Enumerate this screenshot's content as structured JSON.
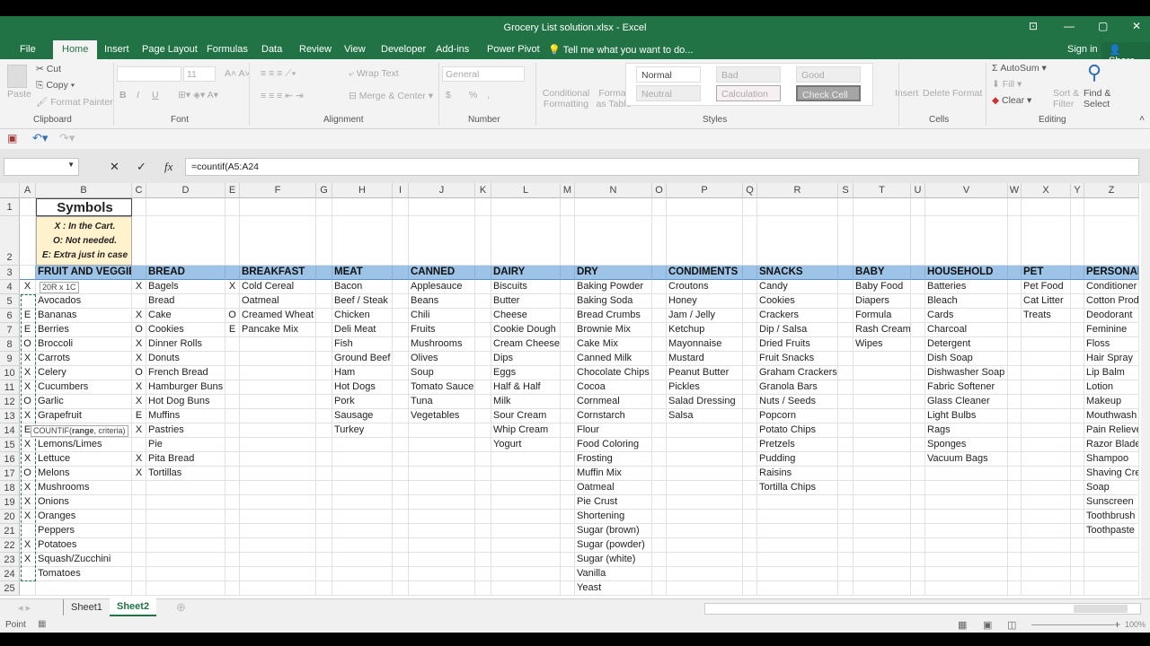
{
  "window": {
    "title": "Grocery List solution.xlsx - Excel",
    "sign_in": "Sign in",
    "share": "Share"
  },
  "menu_tabs": [
    "File",
    "Home",
    "Insert",
    "Page Layout",
    "Formulas",
    "Data",
    "Review",
    "View",
    "Developer",
    "Add-ins",
    "Power Pivot"
  ],
  "tell_me": "Tell me what you want to do...",
  "ribbon": {
    "clipboard": {
      "paste": "Paste",
      "cut": "Cut",
      "copy": "Copy",
      "format_painter": "Format Painter",
      "label": "Clipboard"
    },
    "font": {
      "size": "11",
      "bold": "B",
      "italic": "I",
      "underline": "U",
      "label": "Font"
    },
    "alignment": {
      "wrap_text": "Wrap Text",
      "merge_center": "Merge & Center",
      "label": "Alignment"
    },
    "number": {
      "format": "General",
      "currency": "$",
      "percent": "%",
      "comma": ",",
      "label": "Number"
    },
    "styles": {
      "conditional": "Conditional Formatting",
      "format_table": "Format as Table",
      "normal": "Normal",
      "bad": "Bad",
      "good": "Good",
      "neutral": "Neutral",
      "calculation": "Calculation",
      "check_cell": "Check Cell",
      "label": "Styles"
    },
    "cells": {
      "insert": "Insert",
      "delete": "Delete",
      "format": "Format",
      "label": "Cells"
    },
    "editing": {
      "autosum": "AutoSum",
      "fill": "Fill",
      "clear": "Clear",
      "sort_filter": "Sort & Filter",
      "find_select": "Find & Select",
      "label": "Editing"
    }
  },
  "formula_bar": {
    "name_box": "",
    "formula": "=countif(A5:A24"
  },
  "columns": [
    "A",
    "B",
    "C",
    "D",
    "E",
    "F",
    "G",
    "H",
    "I",
    "J",
    "K",
    "L",
    "M",
    "N",
    "O",
    "P",
    "Q",
    "R",
    "S",
    "T",
    "U",
    "V",
    "W",
    "X",
    "Y",
    "Z"
  ],
  "symbols": {
    "title": "Symbols",
    "lines": [
      "X : In the Cart.",
      "O: Not needed.",
      "E: Extra just in case"
    ]
  },
  "categories": [
    {
      "header": "FRUIT AND VEGGIES",
      "marks": [
        "X",
        "",
        "E",
        "E",
        "O",
        "X",
        "X",
        "X",
        "O",
        "X",
        "E",
        "X",
        "X",
        "O",
        "X",
        "X",
        "X",
        "",
        "X",
        "X",
        ""
      ],
      "items": [
        "",
        "Avocados",
        "Bananas",
        "Berries",
        "Broccoli",
        "Carrots",
        "Celery",
        "Cucumbers",
        "Garlic",
        "Grapefruit",
        "",
        "Lemons/Limes",
        "Lettuce",
        "Melons",
        "Mushrooms",
        "Onions",
        "Oranges",
        "Peppers",
        "Potatoes",
        "Squash/Zucchini",
        "Tomatoes"
      ]
    },
    {
      "header": "BREAD",
      "marks": [
        "X",
        "",
        "X",
        "O",
        "X",
        "X",
        "O",
        "X",
        "X",
        "E",
        "X",
        "",
        "X",
        "X"
      ],
      "items": [
        "Bagels",
        "Bread",
        "Cake",
        "Cookies",
        "Dinner Rolls",
        "Donuts",
        "French Bread",
        "Hamburger Buns",
        "Hot Dog Buns",
        "Muffins",
        "Pastries",
        "Pie",
        "Pita Bread",
        "Tortillas"
      ]
    },
    {
      "header": "BREAKFAST",
      "marks": [
        "X",
        "",
        "O",
        "E"
      ],
      "items": [
        "Cold Cereal",
        "Oatmeal",
        "Creamed Wheat",
        "Pancake Mix"
      ]
    },
    {
      "header": "MEAT",
      "marks": [],
      "items": [
        "Bacon",
        "Beef / Steak",
        "Chicken",
        "Deli Meat",
        "Fish",
        "Ground Beef",
        "Ham",
        "Hot Dogs",
        "Pork",
        "Sausage",
        "Turkey"
      ]
    },
    {
      "header": "CANNED",
      "marks": [],
      "items": [
        "Applesauce",
        "Beans",
        "Chili",
        "Fruits",
        "Mushrooms",
        "Olives",
        "Soup",
        "Tomato Sauce",
        "Tuna",
        "Vegetables"
      ]
    },
    {
      "header": "DAIRY",
      "marks": [],
      "items": [
        "Biscuits",
        "Butter",
        "Cheese",
        "Cookie Dough",
        "Cream Cheese",
        "Dips",
        "Eggs",
        "Half & Half",
        "Milk",
        "Sour Cream",
        "Whip Cream",
        "Yogurt"
      ]
    },
    {
      "header": "DRY",
      "marks": [],
      "items": [
        "Baking Powder",
        "Baking Soda",
        "Bread Crumbs",
        "Brownie Mix",
        "Cake Mix",
        "Canned Milk",
        "Chocolate Chips",
        "Cocoa",
        "Cornmeal",
        "Cornstarch",
        "Flour",
        "Food Coloring",
        "Frosting",
        "Muffin Mix",
        "Oatmeal",
        "Pie Crust",
        "Shortening",
        "Sugar (brown)",
        "Sugar (powder)",
        "Sugar (white)",
        "Vanilla",
        "Yeast"
      ]
    },
    {
      "header": "CONDIMENTS",
      "marks": [],
      "items": [
        "Croutons",
        "Honey",
        "Jam / Jelly",
        "Ketchup",
        "Mayonnaise",
        "Mustard",
        "Peanut Butter",
        "Pickles",
        "Salad Dressing",
        "Salsa"
      ]
    },
    {
      "header": "SNACKS",
      "marks": [],
      "items": [
        "Candy",
        "Cookies",
        "Crackers",
        "Dip / Salsa",
        "Dried Fruits",
        "Fruit Snacks",
        "Graham Crackers",
        "Granola Bars",
        "Nuts / Seeds",
        "Popcorn",
        "Potato Chips",
        "Pretzels",
        "Pudding",
        "Raisins",
        "Tortilla Chips"
      ]
    },
    {
      "header": "BABY",
      "marks": [],
      "items": [
        "Baby Food",
        "Diapers",
        "Formula",
        "Rash Cream",
        "Wipes"
      ]
    },
    {
      "header": "HOUSEHOLD",
      "marks": [],
      "items": [
        "Batteries",
        "Bleach",
        "Cards",
        "Charcoal",
        "Detergent",
        "Dish Soap",
        "Dishwasher Soap",
        "Fabric Softener",
        "Glass Cleaner",
        "Light Bulbs",
        "Rags",
        "Sponges",
        "Vacuum Bags"
      ]
    },
    {
      "header": "PET",
      "marks": [],
      "items": [
        "Pet Food",
        "Cat Litter",
        "Treats"
      ]
    },
    {
      "header": "PERSONAL",
      "marks": [],
      "items": [
        "Conditioner",
        "Cotton Prod",
        "Deodorant",
        "Feminine",
        "Floss",
        "Hair Spray",
        "Lip Balm",
        "Lotion",
        "Makeup",
        "Mouthwash",
        "Pain Relieve",
        "Razor Blade",
        "Shampoo",
        "Shaving Cre",
        "Soap",
        "Sunscreen",
        "Toothbrush",
        "Toothpaste"
      ]
    }
  ],
  "tooltips": {
    "selection_size": "20R x 1C",
    "function_hint_name": "COUNTIF(",
    "function_hint_bold": "range",
    "function_hint_rest": ", criteria)"
  },
  "sheet_tabs": [
    "Sheet1",
    "Sheet2"
  ],
  "active_sheet": "Sheet2",
  "status": {
    "mode": "Point",
    "zoom": "100%"
  },
  "colors": {
    "excel_green": "#217346",
    "header_fill": "#9dc3e6",
    "symbols_fill": "#fff2cc"
  }
}
